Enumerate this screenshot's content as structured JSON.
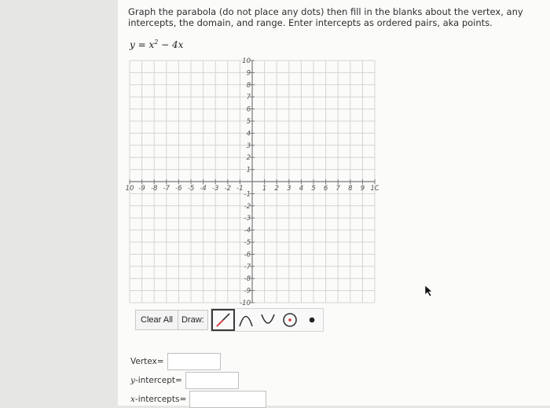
{
  "question": {
    "instructions": "Graph the parabola (do not place any dots) then fill in the blanks about the vertex, any intercepts, the domain, and range. Enter intercepts as ordered pairs, aka points.",
    "equation_lhs": "y",
    "equation_eq": " = ",
    "equation_base": "x",
    "equation_exp": "2",
    "equation_rest": " − 4x"
  },
  "graph": {
    "xmin": -10,
    "xmax": 10,
    "ymin": -10,
    "ymax": 10,
    "x_tick_labels": [
      "10",
      "-9",
      "-8",
      "-7",
      "-6",
      "-5",
      "-4",
      "-3",
      "-2",
      "-1",
      "1",
      "2",
      "3",
      "4",
      "5",
      "6",
      "7",
      "8",
      "9",
      "1C"
    ],
    "y_tick_labels": [
      "10",
      "9",
      "8",
      "7",
      "6",
      "5",
      "4",
      "3",
      "2",
      "1",
      "-1",
      "-2",
      "-3",
      "-4",
      "-5",
      "-6",
      "-7",
      "-8",
      "-9",
      "-10"
    ],
    "grid": true,
    "colors": {
      "grid": "#d4d4d4",
      "axis": "#777777",
      "label": "#555555"
    }
  },
  "toolbar": {
    "clear_all_label": "Clear All",
    "draw_label": "Draw:",
    "tools": [
      "line-tool-icon",
      "parabola-open-down-icon",
      "parabola-open-up-icon",
      "circle-icon",
      "point-icon"
    ]
  },
  "answers": {
    "vertex_label": "Vertex",
    "vertex_eq": " =",
    "y_intercept_var": "y",
    "y_intercept_label": "-intercept",
    "y_intercept_eq": " =",
    "x_intercepts_var": "x",
    "x_intercepts_label": "-intercepts",
    "x_intercepts_eq": " ="
  }
}
